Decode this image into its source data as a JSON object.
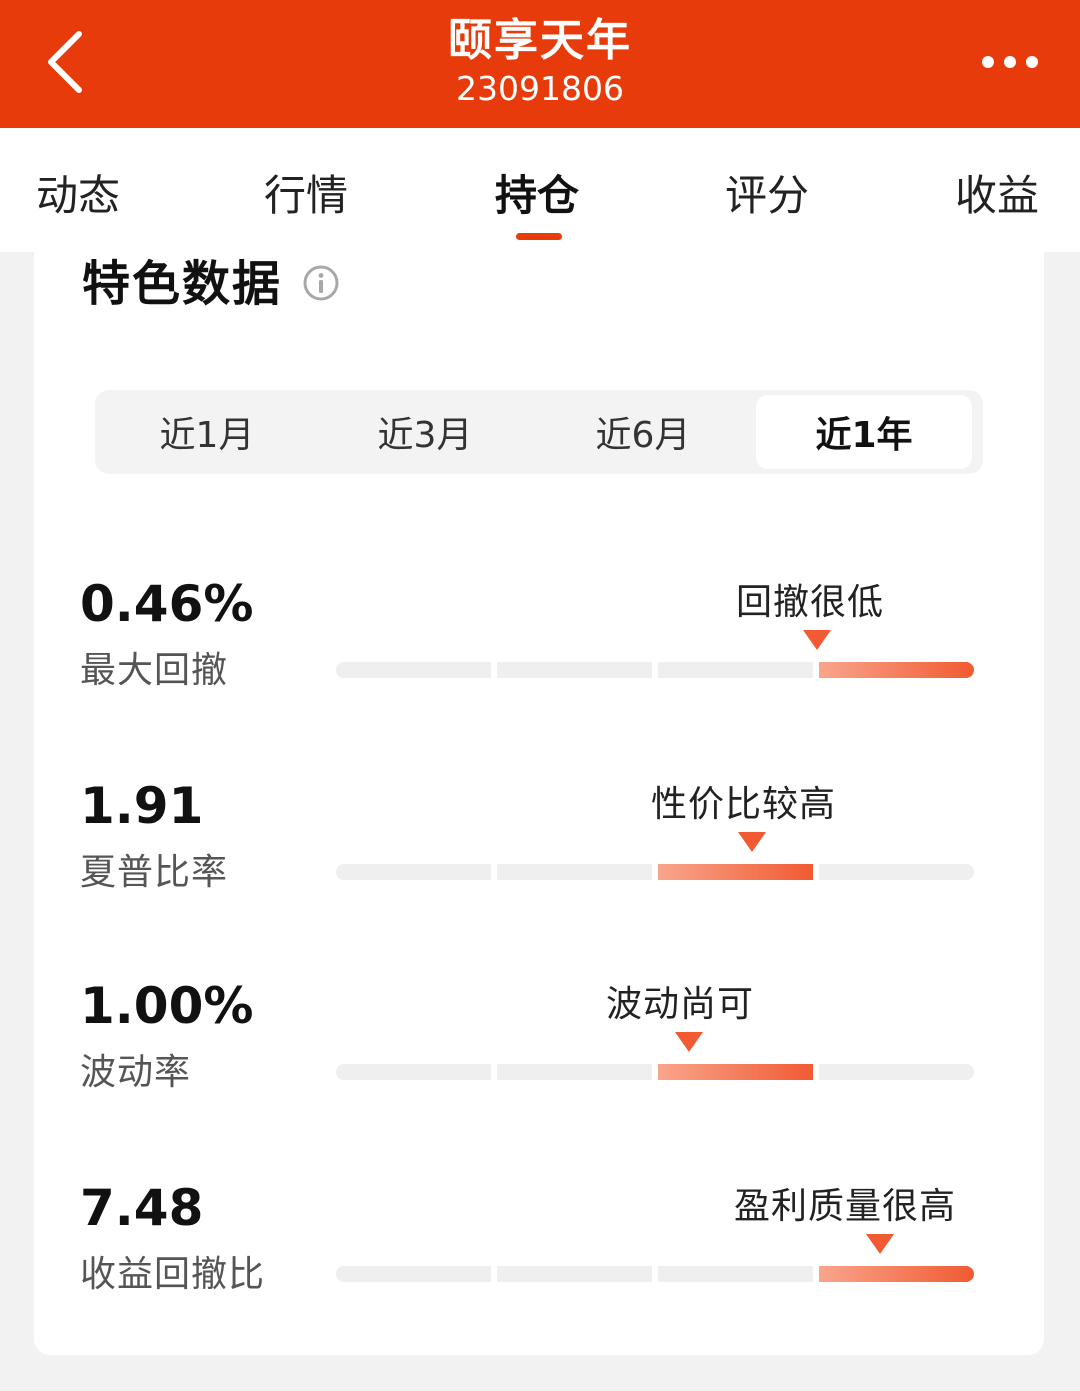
{
  "header": {
    "title": "颐享天年",
    "code": "23091806",
    "back_icon": "chevron-left-icon",
    "more_icon": "more-dots-icon",
    "bg_color": "#e73b0c"
  },
  "tabs": [
    {
      "label": "动态",
      "active": false
    },
    {
      "label": "行情",
      "active": false
    },
    {
      "label": "持仓",
      "active": true
    },
    {
      "label": "评分",
      "active": false
    },
    {
      "label": "收益",
      "active": false
    }
  ],
  "section": {
    "title": "特色数据",
    "info_icon": "info-icon"
  },
  "periods": [
    {
      "label": "近1月",
      "active": false
    },
    {
      "label": "近3月",
      "active": false
    },
    {
      "label": "近6月",
      "active": false
    },
    {
      "label": "近1年",
      "active": true
    }
  ],
  "metrics": [
    {
      "value": "0.46%",
      "label": "最大回撤",
      "tag": "回撤很低",
      "level": 4,
      "segments": 4
    },
    {
      "value": "1.91",
      "label": "夏普比率",
      "tag": "性价比较高",
      "level": 3,
      "segments": 4
    },
    {
      "value": "1.00%",
      "label": "波动率",
      "tag": "波动尚可",
      "level": 3,
      "segments": 4
    },
    {
      "value": "7.48",
      "label": "收益回撤比",
      "tag": "盈利质量很高",
      "level": 4,
      "segments": 4
    }
  ],
  "colors": {
    "accent": "#e73b0c",
    "bar_active": "#f15a32",
    "bar_inactive": "#efefef"
  }
}
